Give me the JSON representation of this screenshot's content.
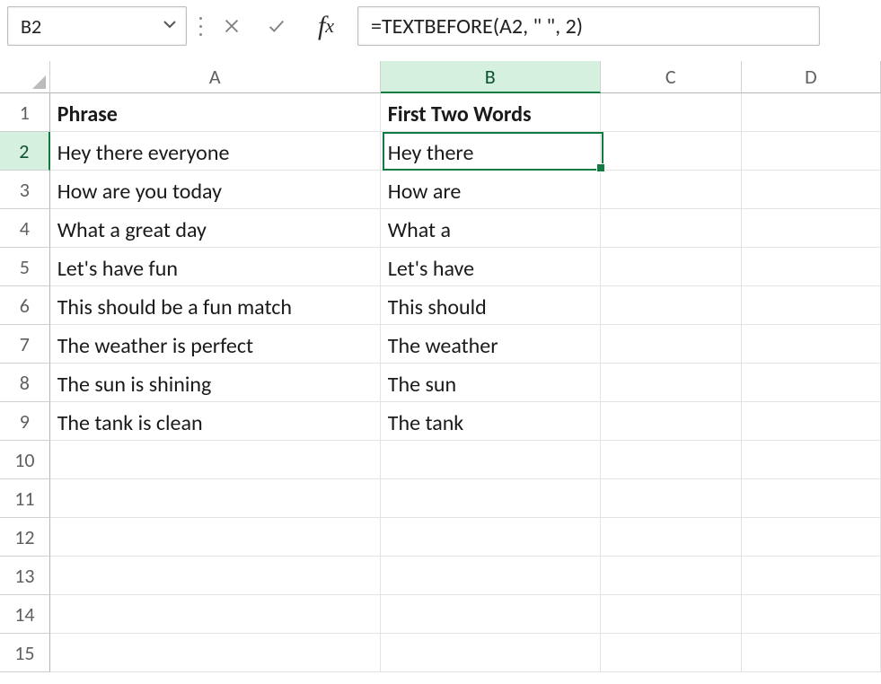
{
  "nameBox": {
    "ref": "B2"
  },
  "formulaBar": {
    "formula": "=TEXTBEFORE(A2, \" \", 2)"
  },
  "columns": [
    "A",
    "B",
    "C",
    "D"
  ],
  "activeColumnIndex": 1,
  "activeRowIndex": 1,
  "selectedCell": {
    "col": 1,
    "row": 1
  },
  "headers": {
    "A": "Phrase",
    "B": "First Two Words"
  },
  "dataRows": [
    {
      "A": "Hey there everyone",
      "B": "Hey there"
    },
    {
      "A": "How are you today",
      "B": "How are"
    },
    {
      "A": "What a great day",
      "B": "What a"
    },
    {
      "A": "Let's have fun",
      "B": "Let's have"
    },
    {
      "A": "This should be a fun match",
      "B": "This should"
    },
    {
      "A": "The weather is perfect",
      "B": "The weather"
    },
    {
      "A": "The sun is shining",
      "B": "The sun"
    },
    {
      "A": "The tank is clean",
      "B": "The tank"
    }
  ],
  "emptyRows": [
    10,
    11,
    12,
    13,
    14,
    15
  ],
  "rowNumbers": [
    1,
    2,
    3,
    4,
    5,
    6,
    7,
    8,
    9,
    10,
    11,
    12,
    13,
    14,
    15
  ]
}
